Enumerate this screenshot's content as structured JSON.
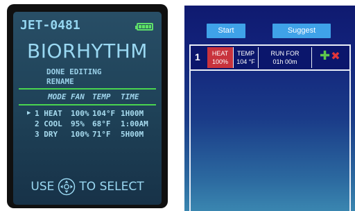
{
  "device": {
    "id": "JET-0481",
    "title": "BIORHYTHM",
    "menu": [
      "DONE EDITING",
      "RENAME"
    ],
    "table_headers": {
      "mode": "MODE",
      "fan": "FAN",
      "temp": "TEMP",
      "time": "TIME"
    },
    "rows": [
      {
        "marker": "▶",
        "mode": "1 HEAT",
        "fan": "100%",
        "temp": "104°F",
        "time": "1H00M"
      },
      {
        "marker": "",
        "mode": "2 COOL",
        "fan": "95%",
        "temp": "68°F",
        "time": "1:00AM"
      },
      {
        "marker": "",
        "mode": "3 DRY",
        "fan": "100%",
        "temp": "71°F",
        "time": "5H00M"
      }
    ],
    "footer": {
      "left": "USE",
      "right": "TO SELECT"
    },
    "colors": {
      "screen": "#1f4258",
      "text": "#9ad8f2",
      "accent": "#4ad54f"
    }
  },
  "app": {
    "buttons": {
      "start": "Start",
      "suggest": "Suggest"
    },
    "steps": [
      {
        "number": "1",
        "mode_label": "HEAT",
        "mode_value": "100%",
        "temp_label": "TEMP",
        "temp_value": "104 °F",
        "run_label": "RUN FOR",
        "run_value": "01h 00m"
      }
    ],
    "icons": {
      "add": "plus-icon",
      "delete": "close-icon"
    },
    "colors": {
      "button": "#3fa2e8",
      "mode_cell": "#c8333d",
      "row_bg": "#0b166c",
      "add": "#5dc84c",
      "delete": "#e2363a"
    }
  }
}
